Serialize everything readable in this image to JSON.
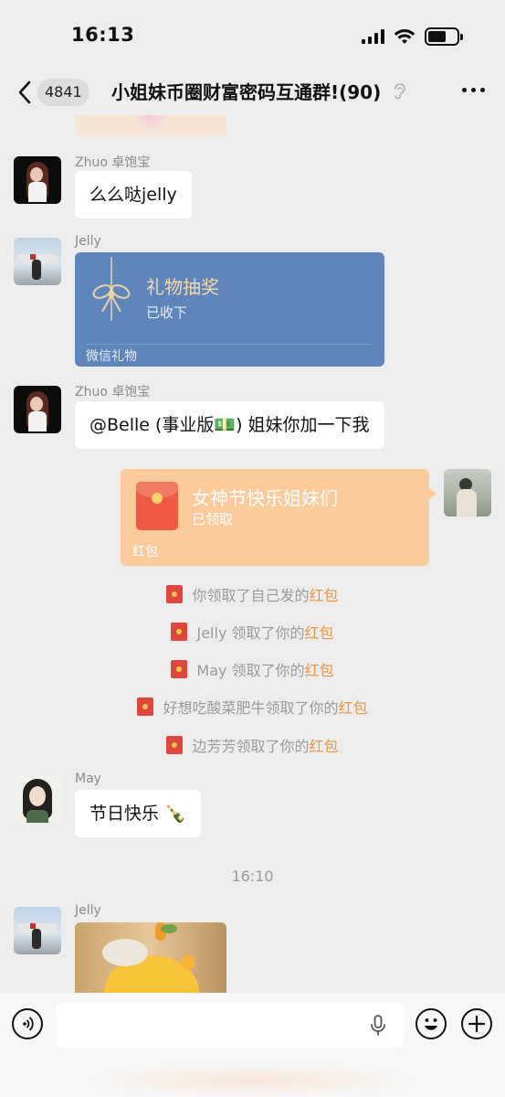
{
  "status_bar": {
    "time": "16:13"
  },
  "nav": {
    "unread_count": "4841",
    "title": "小姐妹币圈财富密码互通群!(90)"
  },
  "messages": [
    {
      "sender": "Zhuo 卓饱宝",
      "text": "么么哒jelly"
    },
    {
      "sender": "Jelly",
      "gift": {
        "title": "礼物抽奖",
        "status": "已收下",
        "footer": "微信礼物"
      }
    },
    {
      "sender": "Zhuo 卓饱宝",
      "text": "@Belle (事业版💵) 姐妹你加一下我"
    },
    {
      "red_packet": {
        "title": "女神节快乐姐妹们",
        "status": "已领取",
        "footer": "红包"
      }
    },
    {
      "sender": "May",
      "text": "节日快乐 🍾"
    },
    {
      "sender": "Jelly"
    }
  ],
  "system_notices": [
    {
      "prefix": "你领取了自己发的",
      "link": "红包"
    },
    {
      "prefix": "Jelly 领取了你的",
      "link": "红包"
    },
    {
      "prefix": "May 领取了你的",
      "link": "红包"
    },
    {
      "prefix": "好想吃酸菜肥牛领取了你的",
      "link": "红包"
    },
    {
      "prefix": "边芳芳领取了你的",
      "link": "红包"
    }
  ],
  "timestamp": "16:10",
  "input": {
    "value": ""
  },
  "colors": {
    "background": "#EDEDED",
    "bubble": "#FFFFFF",
    "gift_card": "#5F86BB",
    "red_packet": "#FBCB9B",
    "red_packet_link": "#E8973F"
  }
}
